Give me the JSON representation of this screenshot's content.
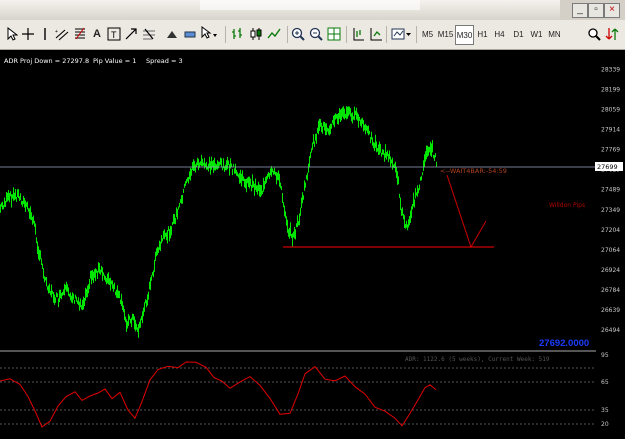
{
  "window": {
    "min_label": "_",
    "restore_label": "▫",
    "close_label": "×"
  },
  "toolbar": {
    "text_tool": "A",
    "text_label_tool": "T",
    "timeframes": [
      "M5",
      "M15",
      "M30",
      "H1",
      "H4",
      "D1",
      "W1",
      "MN"
    ],
    "active_timeframe": "M30"
  },
  "chart": {
    "info": {
      "adr": "ADR Proj Down = 27297.8",
      "pip_value": "Pip Value = 1",
      "spread": "Spread = 3"
    },
    "price_labels": [
      "28339",
      "28199",
      "28059",
      "27914",
      "27769",
      "27629",
      "27489",
      "27349",
      "27204",
      "27064",
      "26924",
      "26784",
      "26639",
      "26494"
    ],
    "current_price": "27699",
    "wait_label": "<--WAIT4BAR:-54:59",
    "side_label": "Willdon Pips",
    "big_price": "27692.0000",
    "indicator_text": "ADR: 1122.6 (5 weeks), Current Week: 519",
    "indicator_levels": [
      "95",
      "65",
      "35",
      "20"
    ],
    "colors": {
      "candles": "#00e600",
      "indicator": "#e00000",
      "annotation": "#c00000",
      "price_label": "#c8c8c8"
    }
  }
}
